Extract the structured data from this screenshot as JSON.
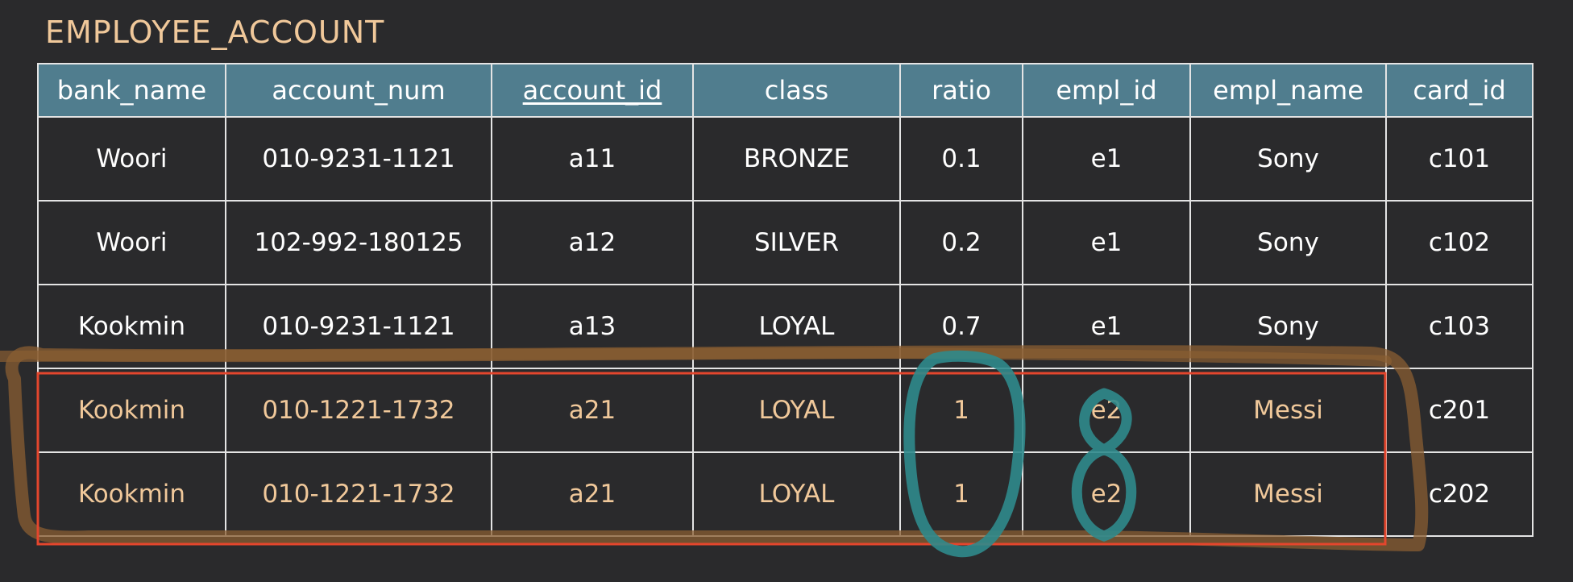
{
  "title": "EMPLOYEE_ACCOUNT",
  "table": {
    "columns": [
      "bank_name",
      "account_num",
      "account_id",
      "class",
      "ratio",
      "empl_id",
      "empl_name",
      "card_id"
    ],
    "primary_key_column": "account_id",
    "rows": [
      [
        "Woori",
        "010-9231-1121",
        "a11",
        "BRONZE",
        "0.1",
        "e1",
        "Sony",
        "c101"
      ],
      [
        "Woori",
        "102-992-180125",
        "a12",
        "SILVER",
        "0.2",
        "e1",
        "Sony",
        "c102"
      ],
      [
        "Kookmin",
        "010-9231-1121",
        "a13",
        "LOYAL",
        "0.7",
        "e1",
        "Sony",
        "c103"
      ],
      [
        "Kookmin",
        "010-1221-1732",
        "a21",
        "LOYAL",
        "1",
        "e2",
        "Messi",
        "c201"
      ],
      [
        "Kookmin",
        "010-1221-1732",
        "a21",
        "LOYAL",
        "1",
        "e2",
        "Messi",
        "c202"
      ]
    ],
    "highlighted_rows": [
      3,
      4
    ]
  },
  "colors": {
    "background": "#2a2a2c",
    "header_fill": "#507d8e",
    "title_text": "#f0c89a",
    "highlight_text": "#f0c89a",
    "highlight_box": "#e4462d",
    "brown_annotation": "#8a5e32",
    "teal_annotation": "#2f8a8c"
  }
}
